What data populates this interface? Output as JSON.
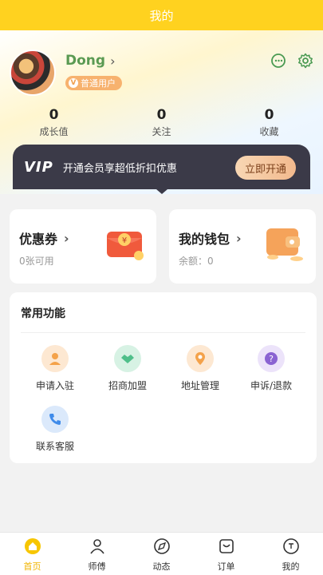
{
  "header": {
    "title": "我的"
  },
  "profile": {
    "username": "Dong",
    "badge": "普通用户",
    "badge_mark": "V",
    "stats": [
      {
        "value": "0",
        "label": "成长值"
      },
      {
        "value": "0",
        "label": "关注"
      },
      {
        "value": "0",
        "label": "收藏"
      }
    ]
  },
  "vip": {
    "logo": "VIP",
    "text": "开通会员享超低折扣优惠",
    "button": "立即开通"
  },
  "coupon": {
    "title": "优惠券",
    "subtitle": "0张可用"
  },
  "wallet": {
    "title": "我的钱包",
    "subtitle": "余额：0"
  },
  "functions": {
    "title": "常用功能",
    "items": [
      {
        "label": "申请入驻",
        "icon": "worker-icon",
        "color": "#f4a24a"
      },
      {
        "label": "招商加盟",
        "icon": "handshake-icon",
        "color": "#4fbf8a"
      },
      {
        "label": "地址管理",
        "icon": "location-icon",
        "color": "#f4a24a"
      },
      {
        "label": "申诉/退款",
        "icon": "question-icon",
        "color": "#8a63d2"
      },
      {
        "label": "联系客服",
        "icon": "phone-icon",
        "color": "#3f8bea"
      }
    ]
  },
  "tabs": [
    {
      "label": "首页",
      "icon": "home-icon"
    },
    {
      "label": "师傅",
      "icon": "master-icon"
    },
    {
      "label": "动态",
      "icon": "compass-icon"
    },
    {
      "label": "订单",
      "icon": "bag-icon"
    },
    {
      "label": "我的",
      "icon": "profile-icon"
    }
  ],
  "colors": {
    "accent": "#ffd21f",
    "username": "#5a9a52",
    "vip_bg": "#3b3a48",
    "active_tab": "#f0b400"
  }
}
